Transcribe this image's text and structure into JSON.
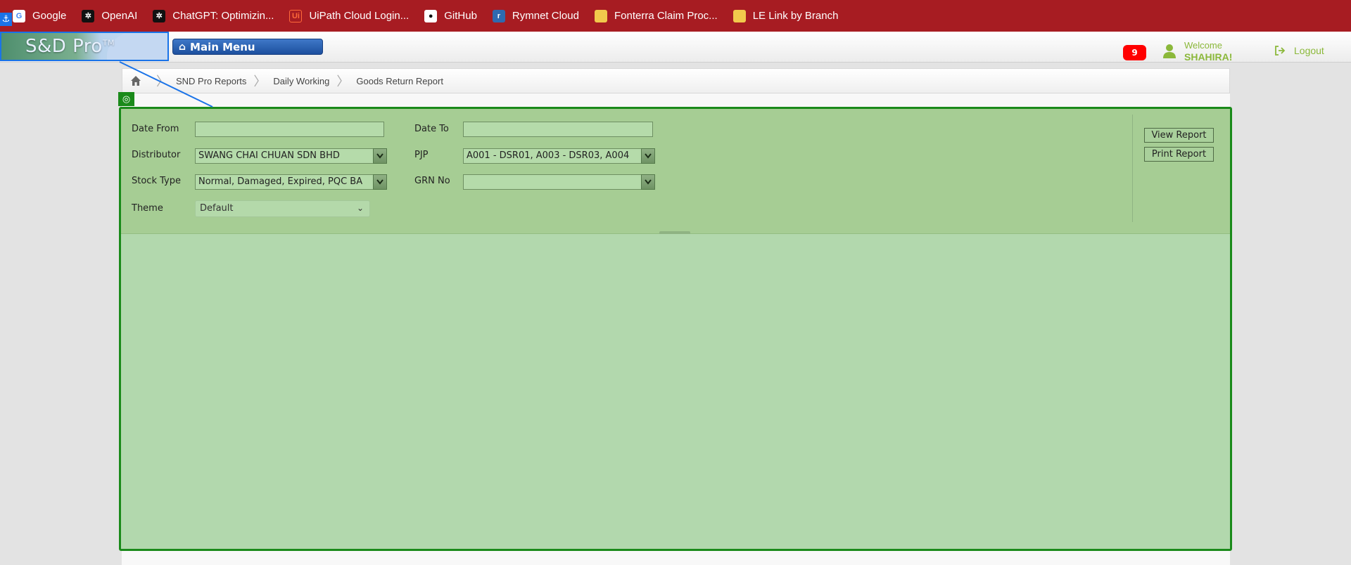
{
  "bookmarks": [
    {
      "label": "Google",
      "icon": "google-icon"
    },
    {
      "label": "OpenAI",
      "icon": "openai-icon"
    },
    {
      "label": "ChatGPT: Optimizin...",
      "icon": "openai-icon"
    },
    {
      "label": "UiPath Cloud Login...",
      "icon": "uipath-icon"
    },
    {
      "label": "GitHub",
      "icon": "github-icon"
    },
    {
      "label": "Rymnet Cloud",
      "icon": "rymnet-icon"
    },
    {
      "label": "Fonterra Claim Proc...",
      "icon": "bookmark-folder-icon"
    },
    {
      "label": "LE Link by Branch",
      "icon": "bookmark-folder-icon"
    }
  ],
  "header": {
    "logo_text": "S&D Pro",
    "logo_tm": "TM",
    "main_menu_label": "Main Menu",
    "notification_count": "9",
    "welcome_label": "Welcome",
    "user_name": "SHAHIRA!",
    "logout_label": "Logout"
  },
  "breadcrumb": [
    "SND Pro Reports",
    "Daily Working",
    "Goods Return Report"
  ],
  "form": {
    "date_from_label": "Date From",
    "date_from_value": "",
    "date_to_label": "Date To",
    "date_to_value": "",
    "distributor_label": "Distributor",
    "distributor_value": "SWANG CHAI CHUAN SDN BHD",
    "pjp_label": "PJP",
    "pjp_value": "A001 - DSR01, A003 - DSR03, A004",
    "stock_type_label": "Stock Type",
    "stock_type_value": "Normal, Damaged, Expired, PQC BA",
    "grn_no_label": "GRN No",
    "grn_no_value": "",
    "theme_label": "Theme",
    "theme_value": "Default"
  },
  "actions": {
    "view_report": "View Report",
    "print_report": "Print Report"
  },
  "colors": {
    "bookmark_bar": "#a71c22",
    "panel_border": "#1a8a1a",
    "panel_fill": "#a6cd94",
    "results_fill": "#b2d8ad",
    "accent_green": "#8bb83a",
    "notification": "#ff0000",
    "main_menu": "#1c4f9e"
  }
}
